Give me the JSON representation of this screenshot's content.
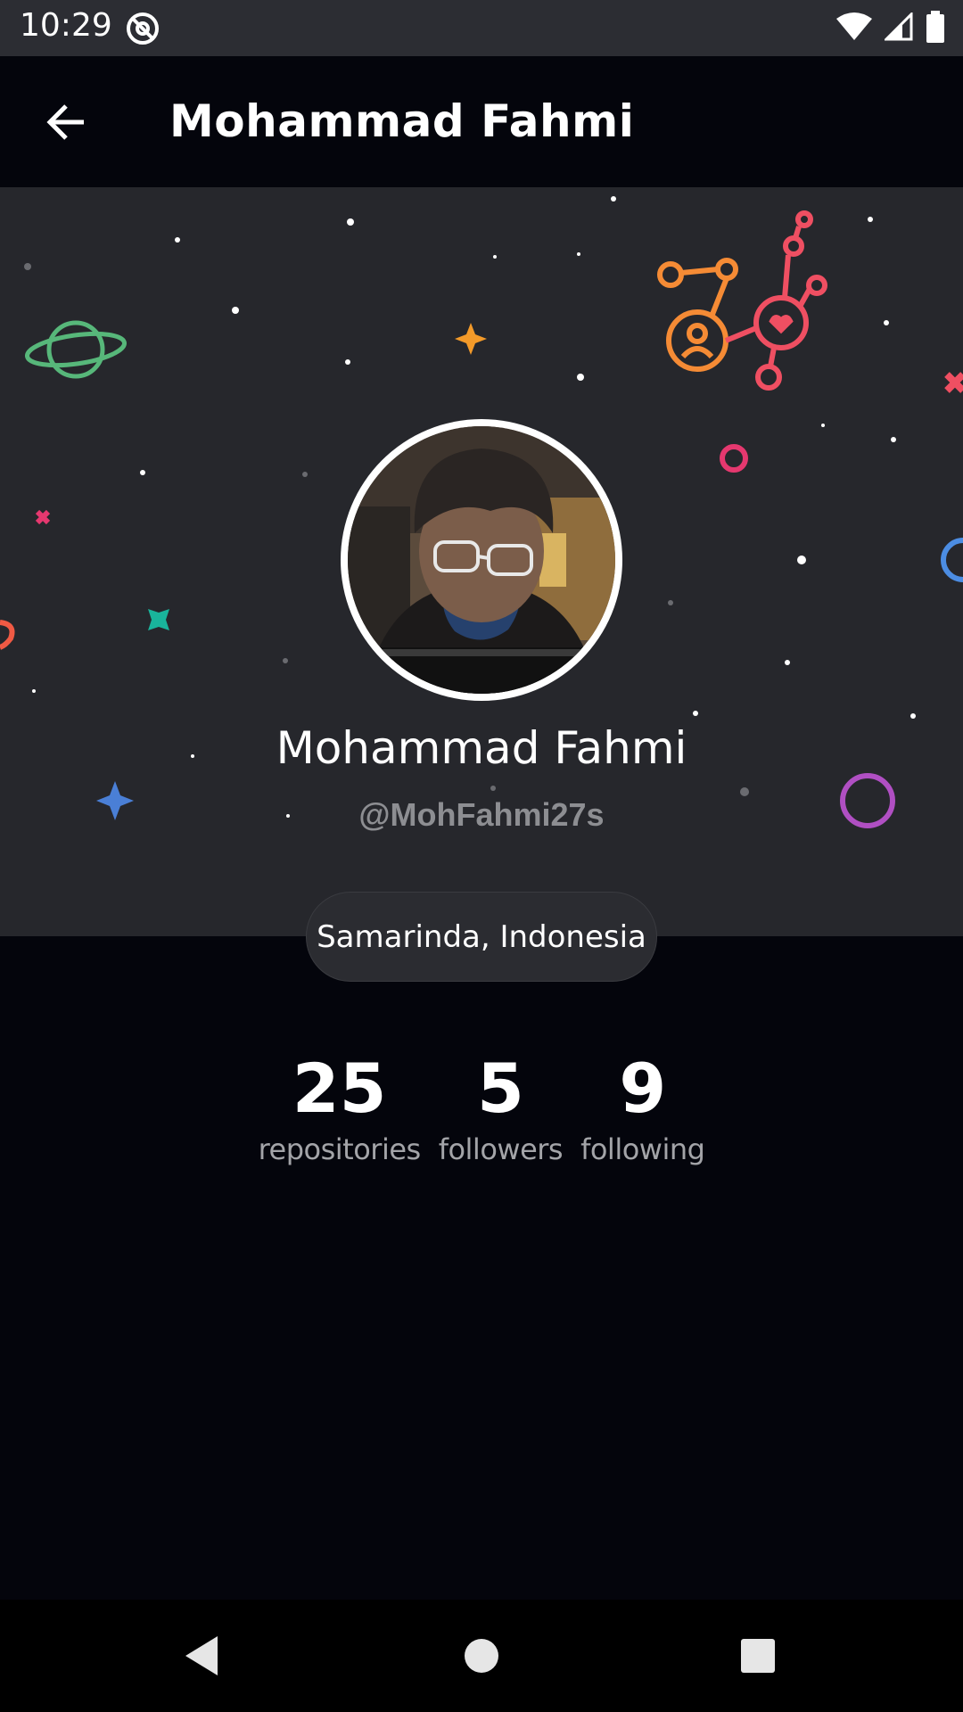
{
  "status_bar": {
    "time": "10:29",
    "app_icon": "at-sign-icon",
    "icons": [
      "wifi-icon",
      "signal-icon",
      "battery-icon"
    ]
  },
  "toolbar": {
    "back_icon": "arrow-left-icon",
    "title": "Mohammad Fahmi"
  },
  "profile": {
    "name": "Mohammad Fahmi",
    "username": "@MohFahmi27s",
    "location": "Samarinda, Indonesia",
    "avatar": "user-avatar-photo"
  },
  "stats": [
    {
      "value": "25",
      "label": "repositories"
    },
    {
      "value": "5",
      "label": "followers"
    },
    {
      "value": "9",
      "label": "following"
    }
  ],
  "nav_bar": {
    "back": "triangle-back-icon",
    "home": "circle-home-icon",
    "recents": "square-recents-icon"
  },
  "colors": {
    "background": "#04050c",
    "header": "#26272c",
    "status_bar": "#2c2d33",
    "chip": "#2b2c31",
    "muted_text": "#8d8e92"
  }
}
